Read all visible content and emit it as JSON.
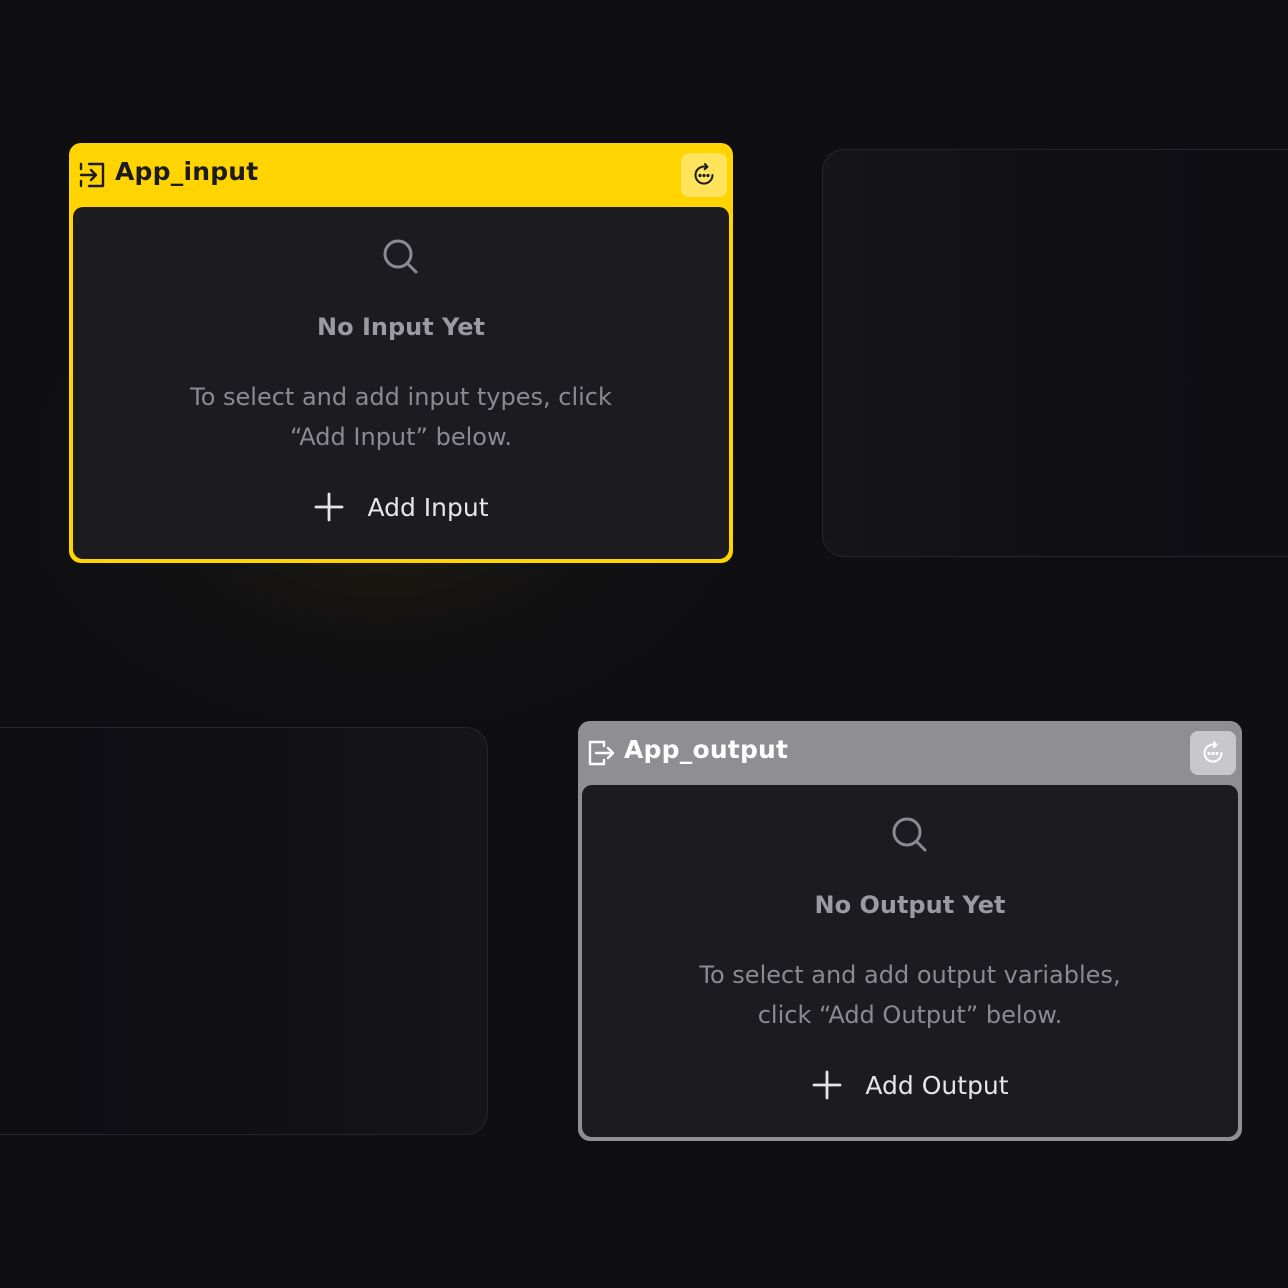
{
  "nodes": {
    "input": {
      "title": "App_input",
      "header_color": "#ffd400",
      "header_icon": "login-arrow-icon",
      "action_icon": "refresh-dots-icon",
      "empty_title": "No Input Yet",
      "empty_description": "To select and add input types, click “Add Input” below.",
      "add_label": "Add Input"
    },
    "output": {
      "title": "App_output",
      "header_color": "#8e8e93",
      "header_icon": "logout-arrow-icon",
      "action_icon": "refresh-dots-icon",
      "empty_title": "No Output Yet",
      "empty_description": "To select and add output variables, click “Add Output” below.",
      "add_label": "Add Output"
    }
  },
  "colors": {
    "background": "#0e0e13",
    "node_body": "#1b1b20",
    "muted_text": "#8a8a90"
  }
}
